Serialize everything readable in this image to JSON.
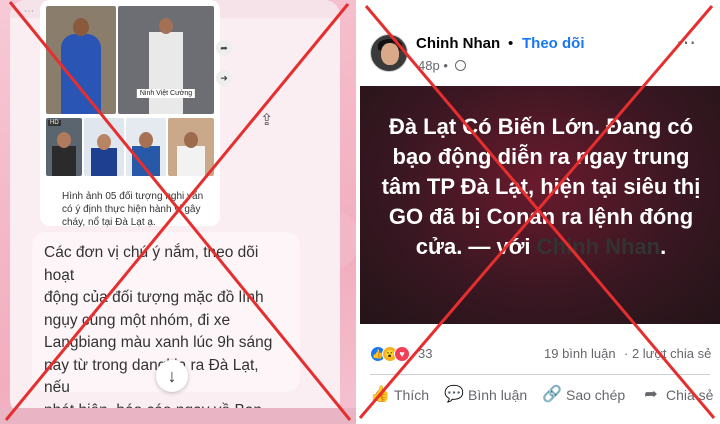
{
  "left": {
    "photo_tags": [
      "Ninh Việt Cường"
    ],
    "hd_badge": "HD",
    "caption": "Hình ảnh 05 đối tượng nghi vấn có ý định thực hiện hành vi gây cháy, nổ tại Đà Lạt ạ.",
    "message_lines": [
      "Các đơn vị chú ý nắm, theo dõi hoạt",
      "động của đối tượng mặc đồ lính",
      "ngụy cùng một nhóm, đi xe",
      "Langbiang màu xanh lúc 9h sáng",
      "nay từ trong dangkia ra Đà Lạt, nếu",
      "phát hiện, báo cáo ngay về Ban"
    ],
    "scroll_down_icon": "arrow-down-icon"
  },
  "right": {
    "author": "Chinh Nhan",
    "separator": "•",
    "follow_label": "Theo dõi",
    "time": "48p",
    "privacy_icon": "globe-icon",
    "more_icon": "ellipsis-icon",
    "post_text": "Đà Lạt Có Biến Lớn. Đang có bạo động diễn ra ngay trung tâm TP Đà Lạt, hiện tại siêu thị GO đã bị Conan ra lệnh đóng cửa.",
    "with_text": " — với ",
    "tagged": "Chinh Nhan",
    "tagged_end": ".",
    "reaction_count": "33",
    "comments": "19 bình luận",
    "shares": "· 2 lượt chia sẻ",
    "actions": {
      "like": "Thích",
      "comment": "Bình luận",
      "copy": "Sao chép",
      "share": "Chia sẻ"
    }
  },
  "colors": {
    "x_mark": "#e62e2e",
    "follow": "#1877f2",
    "post_bg": "#3a1722"
  }
}
